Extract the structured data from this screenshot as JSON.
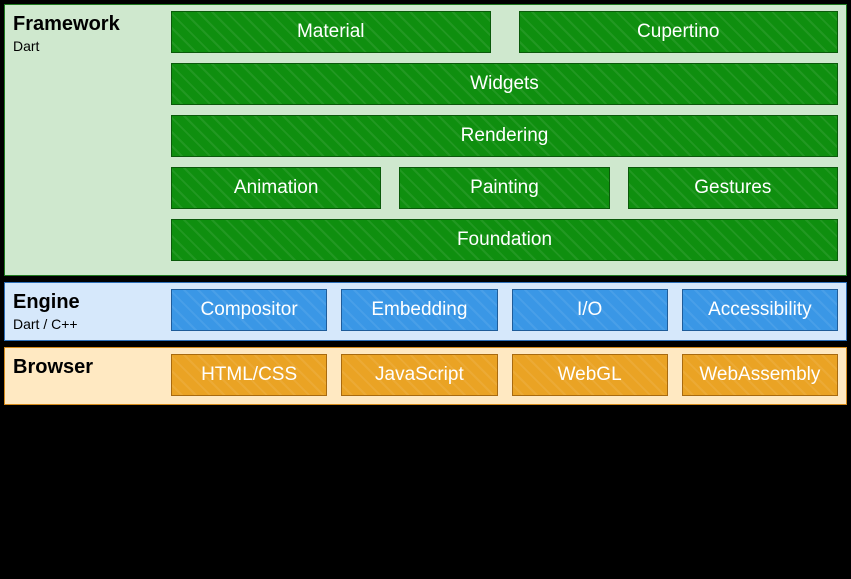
{
  "layers": {
    "framework": {
      "title": "Framework",
      "subtitle": "Dart",
      "rows": [
        [
          "Material",
          "Cupertino"
        ],
        [
          "Widgets"
        ],
        [
          "Rendering"
        ],
        [
          "Animation",
          "Painting",
          "Gestures"
        ],
        [
          "Foundation"
        ]
      ]
    },
    "engine": {
      "title": "Engine",
      "subtitle": "Dart / C++",
      "rows": [
        [
          "Compositor",
          "Embedding",
          "I/O",
          "Accessibility"
        ]
      ]
    },
    "browser": {
      "title": "Browser",
      "subtitle": "",
      "rows": [
        [
          "HTML/CSS",
          "JavaScript",
          "WebGL",
          "WebAssembly"
        ]
      ]
    }
  }
}
